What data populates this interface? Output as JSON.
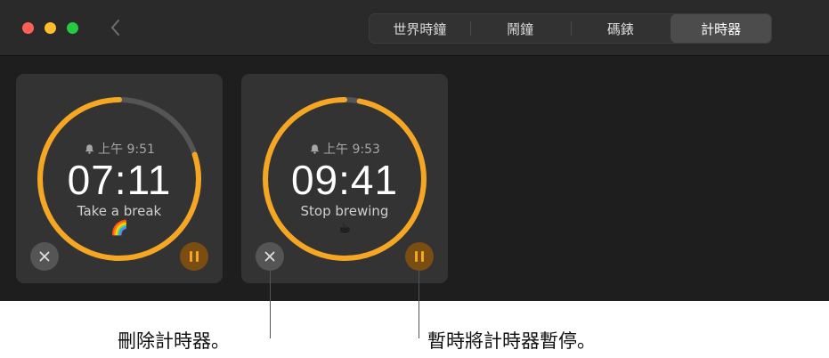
{
  "window": {
    "tabs": [
      {
        "label": "世界時鐘",
        "active": false
      },
      {
        "label": "鬧鐘",
        "active": false
      },
      {
        "label": "碼錶",
        "active": false
      },
      {
        "label": "計時器",
        "active": true
      }
    ],
    "back_icon": "chevron-left-icon"
  },
  "timers": [
    {
      "alarm_time": "上午 9:51",
      "remaining": "07:11",
      "label": "Take a break",
      "emoji": "🌈",
      "progress_remaining": 0.8
    },
    {
      "alarm_time": "上午 9:53",
      "remaining": "09:41",
      "label": "Stop brewing",
      "emoji": "☕",
      "progress_remaining": 0.97
    }
  ],
  "callouts": {
    "delete": "刪除計時器。",
    "pause": "暫時將計時器暫停。"
  },
  "colors": {
    "accent": "#f5a623",
    "track": "#555555",
    "card": "#333333",
    "window_bg": "#1e1e1e"
  }
}
